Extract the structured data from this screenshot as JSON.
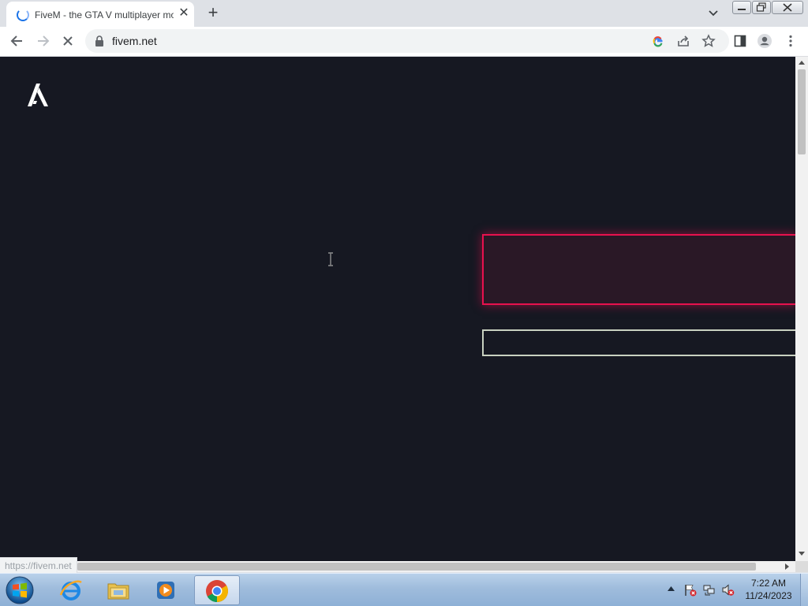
{
  "browser": {
    "tab": {
      "title": "FiveM - the GTA V multiplayer mod",
      "close_glyph": "✕",
      "loading": true
    },
    "new_tab_glyph": "+",
    "toolbar": {
      "back_icon": "back-arrow-icon",
      "forward_icon": "forward-arrow-icon",
      "reload_icon": "loading-stop-icon",
      "url": "fivem.net",
      "omnibox_icons": [
        "google-lens-icon",
        "share-icon",
        "bookmark-star-icon"
      ],
      "side_panel_icon": "side-panel-icon",
      "profile_icon": "profile-icon",
      "menu_icon": "kebab-menu-icon"
    },
    "status_bubble": "https://fivem.net"
  },
  "page": {
    "background": "#161822",
    "logo": "fivem-logo",
    "hero_box_border": "#e8114e",
    "outline_box_border": "#c8d0c0"
  },
  "taskbar": {
    "pinned": [
      "internet-explorer-icon",
      "file-explorer-icon",
      "media-player-icon",
      "chrome-icon"
    ],
    "active": "chrome-icon",
    "tray_icons": [
      "action-center-flag-icon",
      "network-icon",
      "volume-muted-icon"
    ],
    "clock": {
      "time": "7:22 AM",
      "date": "11/24/2023"
    }
  }
}
